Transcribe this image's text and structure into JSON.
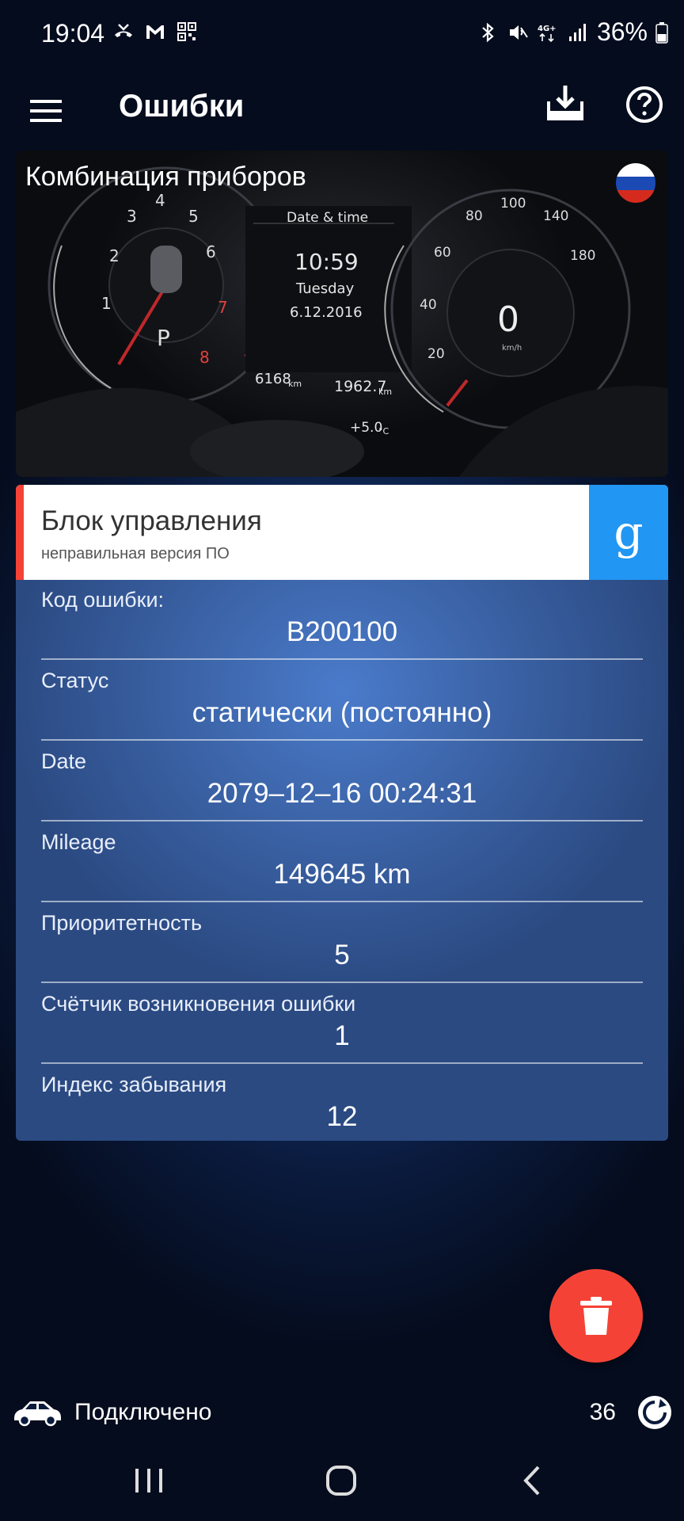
{
  "status_bar": {
    "time": "19:04",
    "battery": "36%"
  },
  "app_bar": {
    "title": "Ошибки"
  },
  "car_card": {
    "title": "Комбинация приборов",
    "flag": "russia-flag-icon",
    "dash": {
      "header": "Date & time",
      "clock": "10:59",
      "weekday": "Tuesday",
      "date": "6.12.2016",
      "odo": "6168",
      "odo_unit": "km",
      "trip": "1962.7",
      "trip_unit": "km",
      "temp": "+5.0",
      "temp_unit": "°C",
      "gear": "P",
      "speed": "0",
      "speed_unit": "km/h",
      "tacho_ticks": [
        "1",
        "2",
        "3",
        "4",
        "5",
        "6",
        "7",
        "8"
      ],
      "speed_ticks": [
        "20",
        "40",
        "60",
        "80",
        "100",
        "140",
        "180"
      ]
    }
  },
  "error_card": {
    "module_name": "Блок управления",
    "module_sub": "неправильная версия ПО",
    "google_label": "g",
    "fields": [
      {
        "label": "Код ошибки:",
        "value": "B200100"
      },
      {
        "label": "Статус",
        "value": "статически (постоянно)"
      },
      {
        "label": "Date",
        "value": "2079–12–16 00:24:31"
      },
      {
        "label": "Mileage",
        "value": "149645 km"
      },
      {
        "label": "Приоритетность",
        "value": "5"
      },
      {
        "label": "Счётчик возникновения ошибки",
        "value": "1"
      },
      {
        "label": "Индекс забывания",
        "value": "12"
      }
    ]
  },
  "connection": {
    "status": "Подключено",
    "count": "36"
  },
  "colors": {
    "accent_red": "#f44336",
    "google_blue": "#2196f3"
  }
}
